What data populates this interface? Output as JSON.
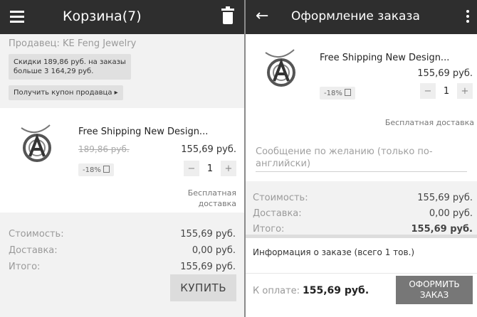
{
  "cart": {
    "title": "Корзина(7)",
    "seller_line": "Продавец: KE Feng Jewelry",
    "discount_line1": "Скидки 189,86 руб. на заказы",
    "discount_line2": "больше 3 164,29 руб.",
    "coupon_label": "Получить купон продавца ▸",
    "product": {
      "title": "Free Shipping New Design...",
      "old_price": "189,86 руб.",
      "new_price": "155,69 руб.",
      "discount": "-18%",
      "qty": "1",
      "minus": "−",
      "plus": "+",
      "shipping_line1": "Бесплатная",
      "shipping_line2": "доставка"
    },
    "totals": {
      "cost_label": "Стоимость:",
      "cost_value": "155,69 руб.",
      "delivery_label": "Доставка:",
      "delivery_value": "0,00 руб.",
      "total_label": "Итого:",
      "total_value": "155,69 руб."
    },
    "buy_label": "КУПИТЬ"
  },
  "checkout": {
    "title": "Оформление заказа",
    "back_icon": "back-arrow-icon",
    "product": {
      "title": "Free Shipping New Design...",
      "new_price": "155,69 руб.",
      "discount": "-18%",
      "qty": "1",
      "minus": "−",
      "plus": "+",
      "shipping": "Бесплатная доставка"
    },
    "note_line1": "Сообщение по желанию (только по-",
    "note_line2": "английски)",
    "totals": {
      "cost_label": "Стоимость:",
      "cost_value": "155,69 руб.",
      "delivery_label": "Доставка:",
      "delivery_value": "0,00 руб.",
      "total_label": "Итого:",
      "total_value": "155,69 руб."
    },
    "order_info": "Информация о заказе (всего 1 тов.)",
    "pay_label": "К оплате:",
    "pay_amount": "155,69 руб.",
    "checkout_line1": "ОФОРМИТЬ",
    "checkout_line2": "ЗАКАЗ"
  }
}
